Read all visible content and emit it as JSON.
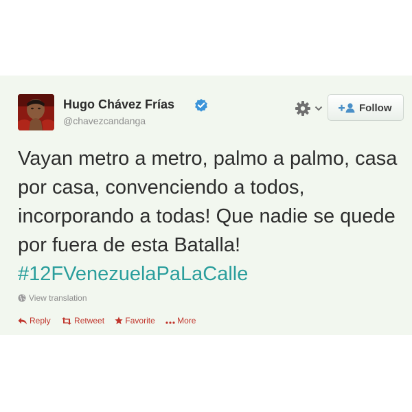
{
  "tweet": {
    "author": {
      "display_name": "Hugo Chávez Frías",
      "handle": "@chavezcandanga",
      "verified": true
    },
    "text_main": "Vayan metro a metro, palmo a palmo, casa por casa, convenciendo a todos, incorporando a todas! Que nadie se quede por fuera de esta Batalla! ",
    "hashtag": "#12FVenezuelaPaLaCalle",
    "view_translation": "View translation",
    "follow_label": "Follow",
    "actions": {
      "reply": "Reply",
      "retweet": "Retweet",
      "favorite": "Favorite",
      "more": "More"
    }
  },
  "icons": {
    "verified": "verified-badge-icon",
    "settings": "gear-icon",
    "dropdown": "chevron-down-icon",
    "follow": "add-user-icon",
    "translate": "globe-icon",
    "reply": "reply-icon",
    "retweet": "retweet-icon",
    "favorite": "star-icon",
    "more": "more-dots-icon"
  },
  "colors": {
    "card_background": "#f2f7ef",
    "hashtag": "#2a9e9c",
    "action_red": "#c0352c",
    "verified_blue": "#3b94d9"
  }
}
